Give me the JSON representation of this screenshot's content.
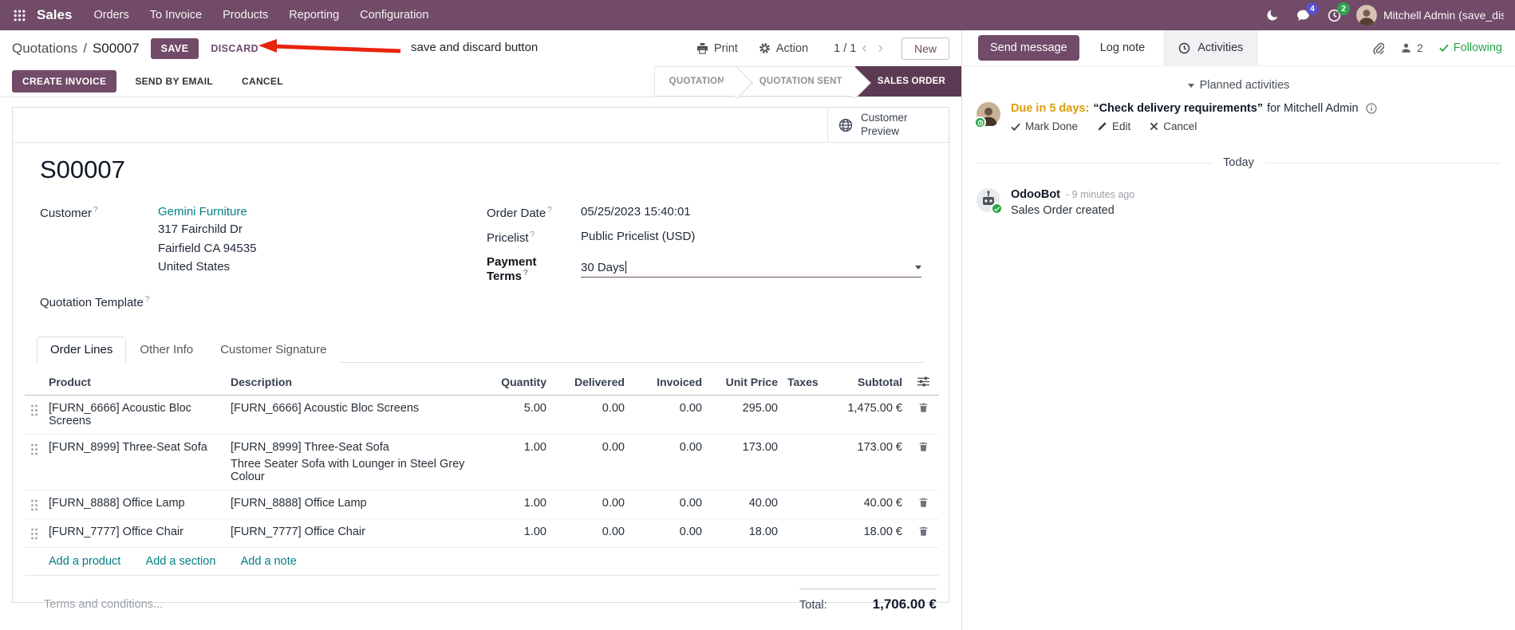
{
  "topbar": {
    "brand": "Sales",
    "menu": [
      "Orders",
      "To Invoice",
      "Products",
      "Reporting",
      "Configuration"
    ],
    "message_badge": "4",
    "activity_badge": "2",
    "user_name": "Mitchell Admin (save_discar"
  },
  "control_panel": {
    "breadcrumb_parent": "Quotations",
    "breadcrumb_sep": "/",
    "breadcrumb_current": "S00007",
    "save": "SAVE",
    "discard": "DISCARD",
    "print": "Print",
    "action": "Action",
    "pager": "1 / 1",
    "new": "New"
  },
  "annotation": {
    "text": "save and discard button"
  },
  "status_row": {
    "create_invoice": "CREATE INVOICE",
    "send_by_email": "SEND BY EMAIL",
    "cancel": "CANCEL",
    "stages": [
      {
        "label": "QUOTATION",
        "active": false
      },
      {
        "label": "QUOTATION SENT",
        "active": false
      },
      {
        "label": "SALES ORDER",
        "active": true
      }
    ]
  },
  "sheet": {
    "customer_preview": "Customer Preview",
    "title": "S00007",
    "help_marker": "?",
    "customer": {
      "label": "Customer",
      "value": "Gemini Furniture",
      "address": [
        "317 Fairchild Dr",
        "Fairfield CA 94535",
        "United States"
      ]
    },
    "quotation_template_label": "Quotation Template",
    "order_date": {
      "label": "Order Date",
      "value": "05/25/2023 15:40:01"
    },
    "pricelist": {
      "label": "Pricelist",
      "value": "Public Pricelist (USD)"
    },
    "payment_terms": {
      "label": "Payment Terms",
      "value": "30 Days"
    },
    "tabs": [
      "Order Lines",
      "Other Info",
      "Customer Signature"
    ],
    "table": {
      "headers": {
        "product": "Product",
        "description": "Description",
        "quantity": "Quantity",
        "delivered": "Delivered",
        "invoiced": "Invoiced",
        "unit_price": "Unit Price",
        "taxes": "Taxes",
        "subtotal": "Subtotal"
      },
      "rows": [
        {
          "product": "[FURN_6666] Acoustic Bloc Screens",
          "desc1": "[FURN_6666] Acoustic Bloc Screens",
          "quantity": "5.00",
          "delivered": "0.00",
          "invoiced": "0.00",
          "unit_price": "295.00",
          "taxes": "",
          "subtotal": "1,475.00 €"
        },
        {
          "product": "[FURN_8999] Three-Seat Sofa",
          "desc1": "[FURN_8999] Three-Seat Sofa",
          "desc2": "Three Seater Sofa with Lounger in Steel Grey Colour",
          "quantity": "1.00",
          "delivered": "0.00",
          "invoiced": "0.00",
          "unit_price": "173.00",
          "taxes": "",
          "subtotal": "173.00 €"
        },
        {
          "product": "[FURN_8888] Office Lamp",
          "desc1": "[FURN_8888] Office Lamp",
          "quantity": "1.00",
          "delivered": "0.00",
          "invoiced": "0.00",
          "unit_price": "40.00",
          "taxes": "",
          "subtotal": "40.00 €"
        },
        {
          "product": "[FURN_7777] Office Chair",
          "desc1": "[FURN_7777] Office Chair",
          "quantity": "1.00",
          "delivered": "0.00",
          "invoiced": "0.00",
          "unit_price": "18.00",
          "taxes": "",
          "subtotal": "18.00 €"
        }
      ],
      "add_links": [
        "Add a product",
        "Add a section",
        "Add a note"
      ]
    },
    "terms_placeholder": "Terms and conditions...",
    "total_label": "Total:",
    "total_value": "1,706.00 €"
  },
  "chatter": {
    "send_message": "Send message",
    "log_note": "Log note",
    "activities": "Activities",
    "followers_count": "2",
    "following": "Following",
    "planned_header": "Planned activities",
    "activity": {
      "due": "Due in 5 days:",
      "summary": "“Check delivery requirements”",
      "assignee": "for Mitchell Admin",
      "mark_done": "Mark Done",
      "edit": "Edit",
      "cancel": "Cancel"
    },
    "day_separator": "Today",
    "message": {
      "author": "OdooBot",
      "time": "- 9 minutes ago",
      "body": "Sales Order created"
    }
  },
  "icons": {
    "apps-grid-icon": "3x3-dots",
    "dark-mode-icon": "crescent-moon",
    "messages-icon": "chat-bubble",
    "activities-icon": "clock",
    "printer-icon": "printer",
    "gear-icon": "gear",
    "chevron-left-icon": "‹",
    "chevron-right-icon": "›",
    "globe-icon": "globe",
    "caret-down-icon": "triangle-down",
    "drag-handle-icon": "six-dots",
    "trash-icon": "trash-can",
    "optional-columns-icon": "sliders",
    "paperclip-icon": "paperclip",
    "followers-icon": "person",
    "check-icon": "check",
    "pencil-icon": "pencil",
    "close-icon": "x",
    "info-icon": "info-circle"
  },
  "colors": {
    "brand": "#714B67",
    "stage_active_bg": "#5D3A53",
    "link": "#017E84",
    "edited_value": "#2C73D2",
    "activity_due": "#DC9D02",
    "success": "#28A745",
    "annotation_arrow": "#E8240F",
    "message_badge": "#5A50C9",
    "activity_badge": "#2EA44F"
  }
}
